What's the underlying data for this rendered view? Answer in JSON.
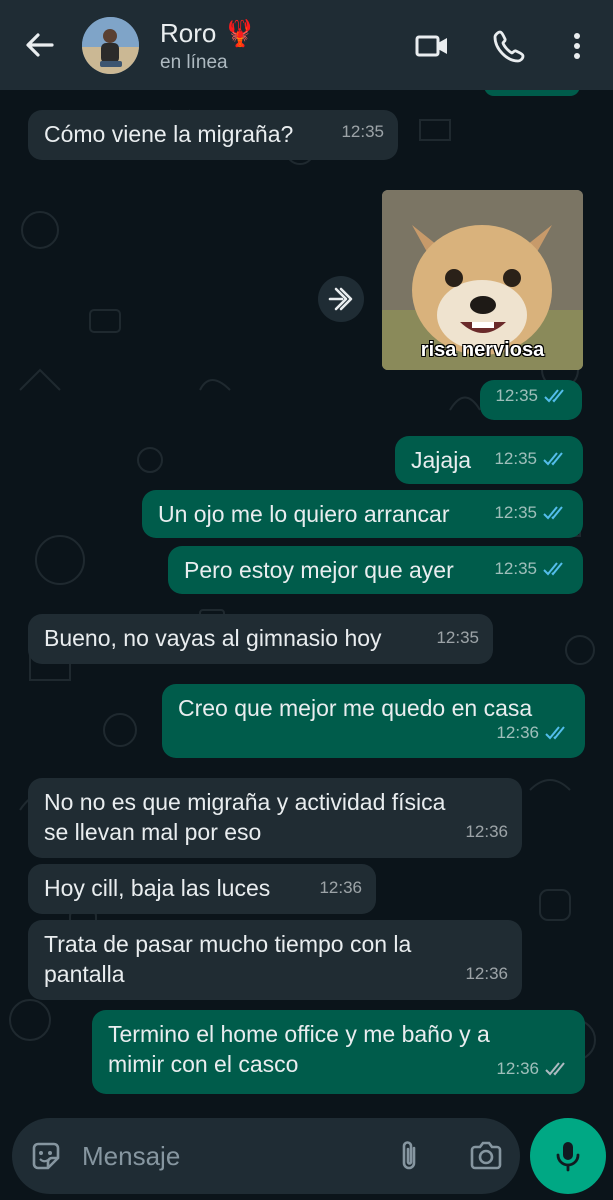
{
  "header": {
    "contact_name": "Roro 🦞",
    "status": "en línea"
  },
  "icons": {
    "back": "arrow-left-icon",
    "video": "video-camera-icon",
    "call": "phone-icon",
    "menu": "more-vertical-icon",
    "forward": "forward-icon",
    "emoji": "sticker-icon",
    "attach": "paperclip-icon",
    "camera": "camera-icon",
    "mic": "microphone-icon"
  },
  "colors": {
    "header_bg": "#1f2c34",
    "chat_bg": "#0b141a",
    "incoming_bubble": "#202c33",
    "outgoing_bubble": "#005c4b",
    "read_ticks": "#53bdeb",
    "mic_button": "#00a884"
  },
  "sticker": {
    "caption": "risa nerviosa",
    "time": "12:35"
  },
  "messages": [
    {
      "dir": "in",
      "text": "Cómo viene la migraña?",
      "time": "12:35"
    },
    {
      "dir": "out",
      "text": "Jajaja",
      "time": "12:35",
      "status": "read"
    },
    {
      "dir": "out",
      "text": "Un ojo me lo quiero arrancar",
      "time": "12:35",
      "status": "read"
    },
    {
      "dir": "out",
      "text": "Pero estoy mejor que ayer",
      "time": "12:35",
      "status": "read"
    },
    {
      "dir": "in",
      "text": "Bueno, no vayas al gimnasio hoy",
      "time": "12:35"
    },
    {
      "dir": "out",
      "text": "Creo que mejor me quedo en casa",
      "time": "12:36",
      "status": "read"
    },
    {
      "dir": "in",
      "text": "No no es que migraña y actividad física\nse llevan mal por eso",
      "time": "12:36"
    },
    {
      "dir": "in",
      "text": "Hoy cill, baja las luces",
      "time": "12:36"
    },
    {
      "dir": "in",
      "text": "Trata de pasar mucho tiempo con la\npantalla",
      "time": "12:36"
    },
    {
      "dir": "out",
      "text": "Termino el home office y me baño y a\nmimir con el casco",
      "time": "12:36",
      "status": "delivered"
    }
  ],
  "composer": {
    "placeholder": "Mensaje"
  }
}
